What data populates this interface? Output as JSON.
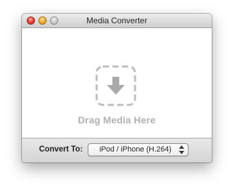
{
  "window": {
    "title": "Media Converter"
  },
  "dropzone": {
    "label": "Drag Media Here",
    "icon": "download-arrow-icon"
  },
  "footer": {
    "convert_label": "Convert To:",
    "format_selected": "iPod / iPhone (H.264)"
  },
  "colors": {
    "dropzone_border": "#bdbdbd",
    "dropzone_text": "#b0b0b0",
    "close_button": "#e8473b",
    "minimize_button": "#f0b13a",
    "zoom_button": "#cfcfcf"
  }
}
